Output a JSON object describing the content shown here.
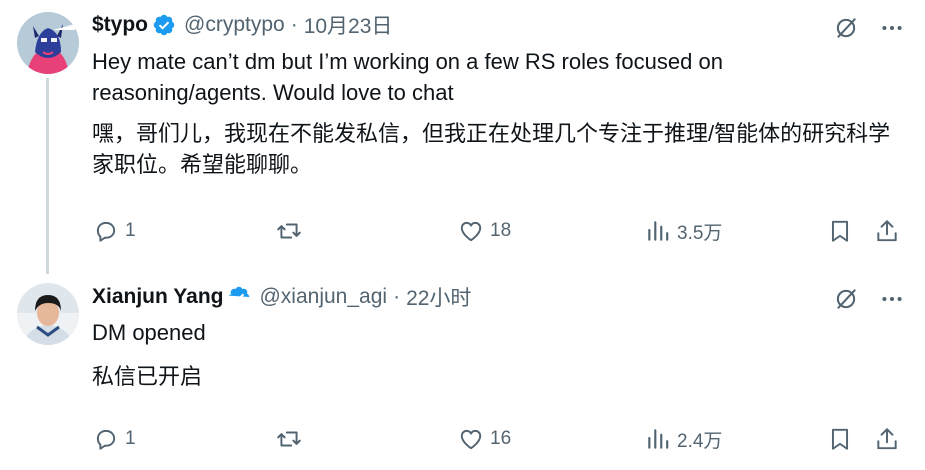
{
  "tweets": [
    {
      "author_name": "$typo",
      "handle": "@cryptypo",
      "separator": "·",
      "time": "10月23日",
      "text_en": "Hey mate can’t dm but I’m working on a few RS roles focused on reasoning/agents. Would love to chat",
      "text_zh": "嘿，哥们儿，我现在不能发私信，但我正在处理几个专注于推理/智能体的研究科学家职位。希望能聊聊。",
      "replies": "1",
      "retweets": "",
      "likes": "18",
      "views": "3.5万"
    },
    {
      "author_name": "Xianjun Yang",
      "handle": "@xianjun_agi",
      "separator": "·",
      "time": "22小时",
      "text_en": "DM opened",
      "text_zh": "私信已开启",
      "replies": "1",
      "retweets": "",
      "likes": "16",
      "views": "2.4万"
    }
  ],
  "colors": {
    "text": "#0f1419",
    "muted": "#536471",
    "verified": "#1d9bf0",
    "thread_line": "#cfd9de"
  },
  "icons": [
    "grok-icon",
    "more-icon",
    "reply-icon",
    "retweet-icon",
    "like-icon",
    "views-icon",
    "bookmark-icon",
    "share-icon",
    "verified-badge-icon"
  ]
}
